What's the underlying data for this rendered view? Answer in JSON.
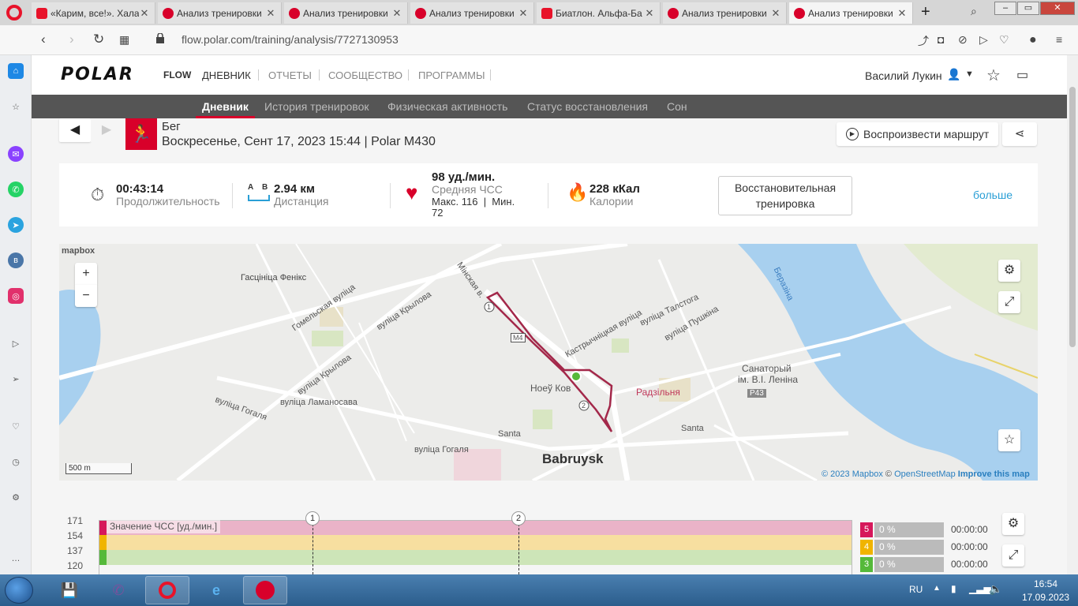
{
  "browser": {
    "tabs": [
      {
        "title": "«Карим, все!». Хала",
        "icon": "youtube-icon"
      },
      {
        "title": "Анализ тренировки",
        "icon": "polar-icon"
      },
      {
        "title": "Анализ тренировки",
        "icon": "polar-icon"
      },
      {
        "title": "Анализ тренировки",
        "icon": "polar-icon"
      },
      {
        "title": "Биатлон. Альфа-Ба",
        "icon": "youtube-icon"
      },
      {
        "title": "Анализ тренировки",
        "icon": "polar-icon"
      },
      {
        "title": "Анализ тренировки",
        "icon": "polar-icon",
        "active": true
      }
    ],
    "url": "flow.polar.com/training/analysis/7727130953"
  },
  "nav": {
    "logo": "POLAR",
    "flow": "FLOW",
    "items": [
      "ДНЕВНИК",
      "ОТЧЕТЫ",
      "СООБЩЕСТВО",
      "ПРОГРАММЫ"
    ],
    "user": "Василий Лукин"
  },
  "subnav": [
    "Дневник",
    "История тренировок",
    "Физическая активность",
    "Статус восстановления",
    "Сон"
  ],
  "session": {
    "sport": "Бег",
    "date": "Воскресенье, Сент 17, 2023 15:44 | Polar M430",
    "replay_label": "Воспроизвести маршрут"
  },
  "stats": {
    "duration": {
      "value": "00:43:14",
      "label": "Продолжительность"
    },
    "distance": {
      "value": "2.94 км",
      "label": "Дистанция",
      "ab": "A    B"
    },
    "hr": {
      "value": "98 уд./мин.",
      "label": "Средняя ЧСС",
      "detail1": "Макс. 116  |  Мин.",
      "detail2": "72"
    },
    "calories": {
      "value": "228 кКал",
      "label": "Калории"
    },
    "recovery_line1": "Восстановительная",
    "recovery_line2": "тренировка",
    "more": "больше"
  },
  "map": {
    "logo": "mapbox",
    "scale": "500 m",
    "labels": {
      "finiks": "Гасцініца Фенікс",
      "city": "Babruysk",
      "noev": "Ноеў Ков",
      "radzilnia": "Радзільня",
      "santa1": "Santa",
      "santa2": "Santa",
      "sanatory1": "Санаторый",
      "sanatory2": "ім. В.І. Леніна",
      "berazina": "Беразіна",
      "p43": "P43",
      "m4": "M4",
      "krylova1": "вуліца Крылова",
      "krylova2": "вуліца Крылова",
      "gogalia1": "вуліца Гогаля",
      "gogalia2": "вуліца Гогаля",
      "lamanosava": "вуліца Ламаносава",
      "homelskaya": "Гомельская вуліца",
      "minskaya": "Мінская в.",
      "talstoga": "вуліца Талстога",
      "pushkina": "вуліца Пушкіна",
      "kastrychnitskaya": "Кастрычніцкая вуліца",
      "lap1": "1",
      "lap2": "2"
    },
    "attribution": {
      "c1": "© 2023 Mapbox",
      "c2": "©",
      "osm": "OpenStreetMap",
      "improve": "Improve this map"
    }
  },
  "hr_chart": {
    "label": "Значение ЧСС [уд./мин.]",
    "ticks": [
      "171",
      "154",
      "137",
      "120"
    ],
    "laps": [
      "1",
      "2"
    ],
    "zones": [
      {
        "zone": "5",
        "pct": "0 %",
        "time": "00:00:00",
        "color": "#d6185b"
      },
      {
        "zone": "4",
        "pct": "0 %",
        "time": "00:00:00",
        "color": "#f0b400"
      },
      {
        "zone": "3",
        "pct": "0 %",
        "time": "00:00:00",
        "color": "#55b93a"
      }
    ]
  },
  "taskbar": {
    "lang": "RU",
    "time": "16:54",
    "date": "17.09.2023"
  }
}
